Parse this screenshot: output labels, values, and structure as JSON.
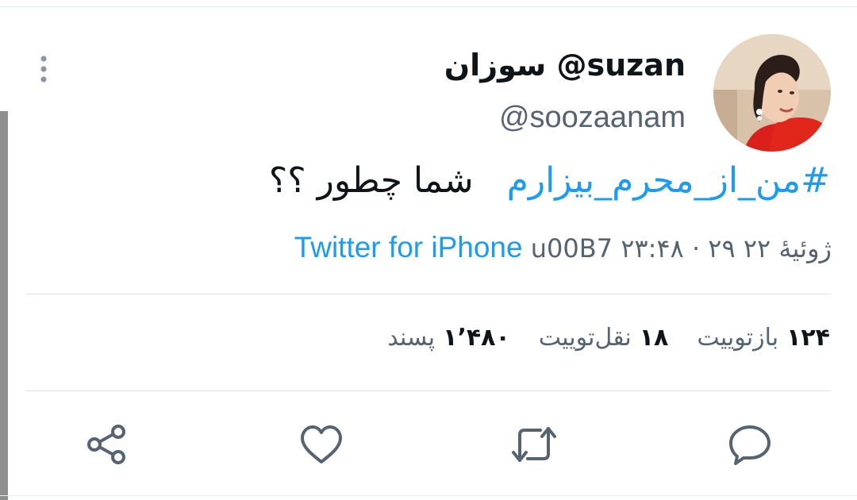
{
  "user": {
    "display_name": "سوزان @suzan",
    "handle": "@soozaanam"
  },
  "tweet": {
    "hashtag": "#من_از_محرم_بیزارم",
    "text_after": "شما چطور ؟؟"
  },
  "meta": {
    "time_date": "۲۳:۴۸ · ۲۹ ژوئیهٔ ۲۲",
    "separator": "u00B7",
    "source": "Twitter for iPhone"
  },
  "stats": {
    "retweets_count": "۱۲۴",
    "retweets_label": "بازتوییت",
    "quotes_count": "۱۸",
    "quotes_label": "نقل‌توییت",
    "likes_count": "۱٬۴۸۰",
    "likes_label": "پسند"
  },
  "colors": {
    "accent": "#1d9bf0",
    "secondary_text": "#566370",
    "icon": "#566370"
  },
  "icons": {
    "more": "more-vertical-icon",
    "reply": "reply-icon",
    "retweet": "retweet-icon",
    "like": "heart-icon",
    "share": "share-icon"
  }
}
